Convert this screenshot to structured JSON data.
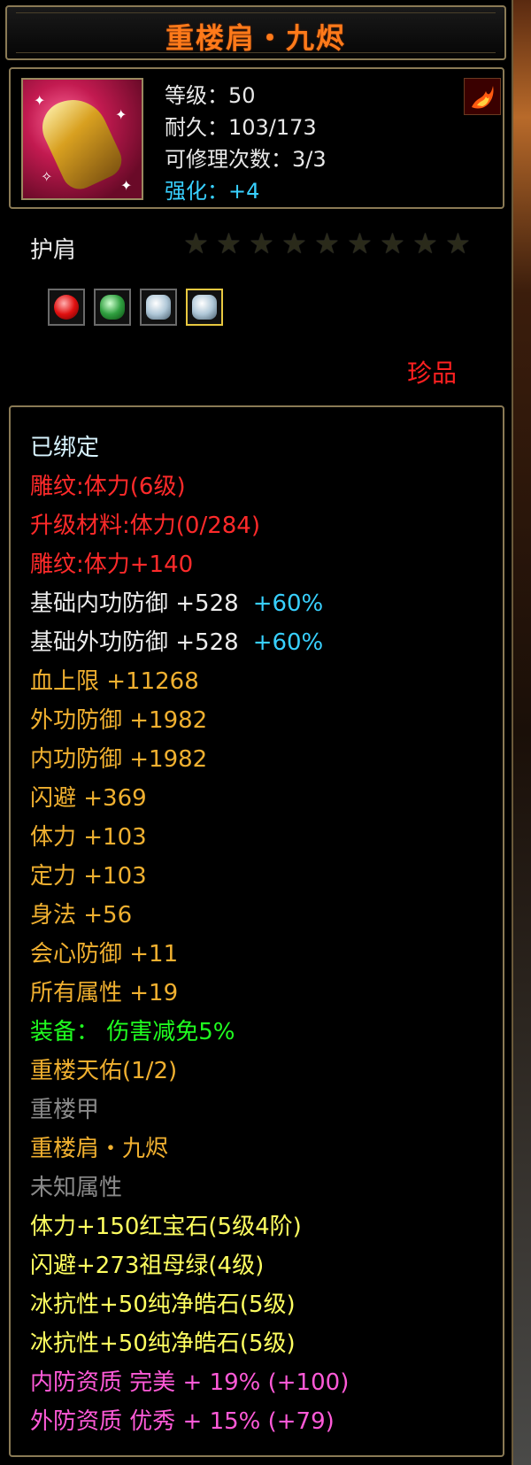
{
  "title": "重楼肩・九烬",
  "header": {
    "level": "等级：50",
    "durability": "耐久：103/173",
    "repair": "可修理次数：3/3",
    "enhance": "强化：+4"
  },
  "type_label": "护肩",
  "stars": {
    "filled": 0,
    "total": 9
  },
  "gems": [
    "ruby-icon",
    "emerald-icon",
    "diamond-icon",
    "diamond-icon"
  ],
  "rarity": "珍品",
  "attributes": [
    {
      "text": "已绑定",
      "color": "cyanwhite"
    },
    {
      "text": "雕纹:体力(6级)",
      "color": "red"
    },
    {
      "text": "升级材料:体力(0/284)",
      "color": "red"
    },
    {
      "text": "雕纹:体力+140",
      "color": "red"
    },
    {
      "text": "基础内功防御  +528",
      "extra": "+60%",
      "color": "white"
    },
    {
      "text": "基础外功防御  +528",
      "extra": "+60%",
      "color": "white"
    },
    {
      "text": "血上限  +11268",
      "color": "orange"
    },
    {
      "text": "外功防御  +1982",
      "color": "orange"
    },
    {
      "text": "内功防御  +1982",
      "color": "orange"
    },
    {
      "text": "闪避  +369",
      "color": "orange"
    },
    {
      "text": "体力  +103",
      "color": "orange"
    },
    {
      "text": "定力  +103",
      "color": "orange"
    },
    {
      "text": "身法  +56",
      "color": "orange"
    },
    {
      "text": "会心防御  +11",
      "color": "orange"
    },
    {
      "text": "所有属性  +19",
      "color": "orange"
    },
    {
      "text": "装备：  伤害减免5%",
      "color": "green"
    },
    {
      "text": "重楼天佑(1/2)",
      "color": "orange"
    },
    {
      "text": "重楼甲",
      "color": "gray"
    },
    {
      "text": "重楼肩・九烬",
      "color": "orange"
    },
    {
      "text": "未知属性",
      "color": "gray"
    },
    {
      "text": "体力+150红宝石(5级4阶)",
      "color": "yellow"
    },
    {
      "text": "闪避+273祖母绿(4级)",
      "color": "yellow"
    },
    {
      "text": "冰抗性+50纯净皓石(5级)",
      "color": "yellow"
    },
    {
      "text": "冰抗性+50纯净皓石(5级)",
      "color": "yellow"
    },
    {
      "text": "内防资质  完美  +  19%  (+100)",
      "color": "pink"
    },
    {
      "text": "外防资质  优秀  +  15%  (+79)",
      "color": "pink"
    }
  ],
  "colors": {
    "title": "#ff7a1a",
    "border": "#8a7a55",
    "enhance": "#38d0ff",
    "rarity": "#ff2020"
  }
}
